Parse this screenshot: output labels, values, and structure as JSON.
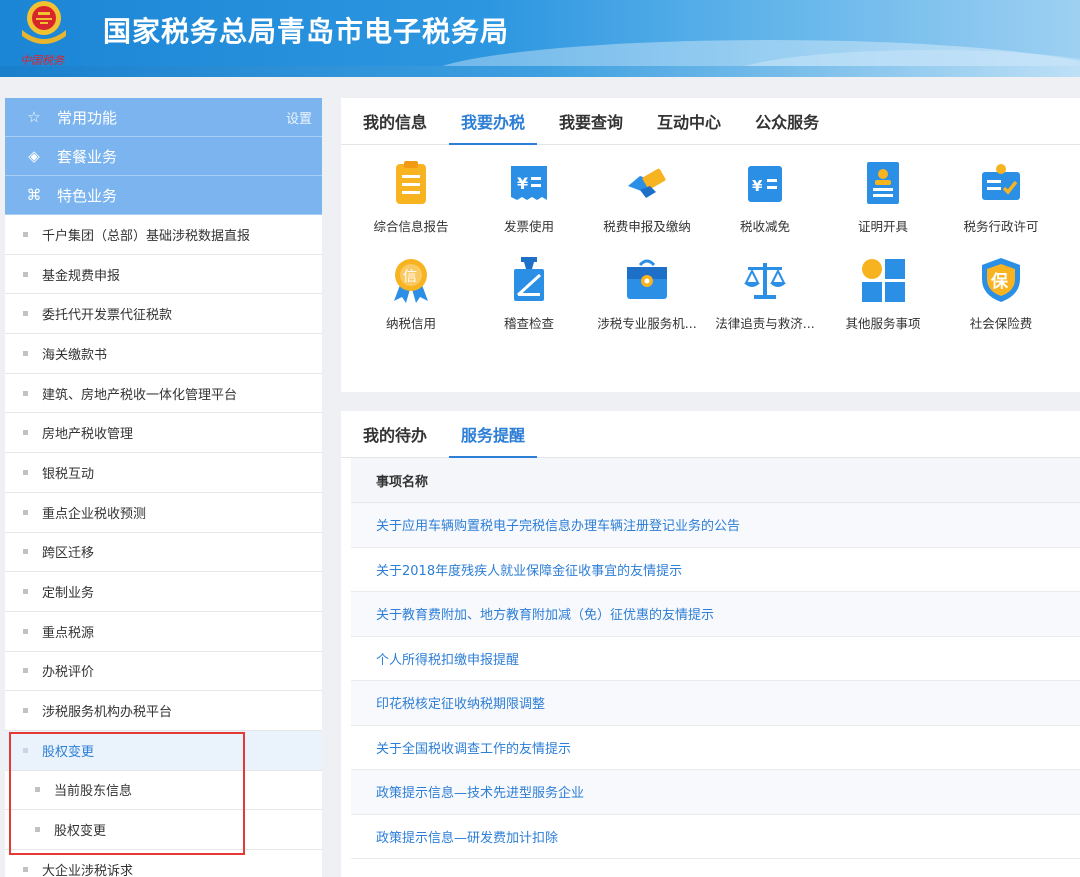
{
  "header": {
    "title": "国家税务总局青岛市电子税务局",
    "emblem_caption": "中国税务"
  },
  "sidebar": {
    "heads": [
      {
        "label": "常用功能",
        "icon": "star-icon",
        "extra": "设置"
      },
      {
        "label": "套餐业务",
        "icon": "layers-icon"
      },
      {
        "label": "特色业务",
        "icon": "cluster-icon"
      }
    ],
    "items": [
      "千户集团（总部）基础涉税数据直报",
      "基金规费申报",
      "委托代开发票代征税款",
      "海关缴款书",
      "建筑、房地产税收一体化管理平台",
      "房地产税收管理",
      "银税互动",
      "重点企业税收预测",
      "跨区迁移",
      "定制业务",
      "重点税源",
      "办税评价",
      "涉税服务机构办税平台",
      "股权变更",
      "当前股东信息",
      "股权变更",
      "大企业涉税诉求"
    ]
  },
  "main_tabs": [
    "我的信息",
    "我要办税",
    "我要查询",
    "互动中心",
    "公众服务"
  ],
  "services": [
    {
      "label": "综合信息报告",
      "icon": "clipboard-icon"
    },
    {
      "label": "发票使用",
      "icon": "invoice-icon"
    },
    {
      "label": "税费申报及缴纳",
      "icon": "payment-icon"
    },
    {
      "label": "税收减免",
      "icon": "tax-reduction-icon"
    },
    {
      "label": "证明开具",
      "icon": "certificate-icon"
    },
    {
      "label": "税务行政许可",
      "icon": "permit-icon"
    },
    {
      "label": "纳税信用",
      "icon": "credit-medal-icon"
    },
    {
      "label": "稽查检查",
      "icon": "inspection-icon"
    },
    {
      "label": "涉税专业服务机...",
      "icon": "briefcase-icon"
    },
    {
      "label": "法律追责与救济...",
      "icon": "scales-icon"
    },
    {
      "label": "其他服务事项",
      "icon": "grid-icon"
    },
    {
      "label": "社会保险费",
      "icon": "shield-bao-icon"
    }
  ],
  "todo_tabs": [
    "我的待办",
    "服务提醒"
  ],
  "table": {
    "header": "事项名称",
    "rows": [
      "关于应用车辆购置税电子完税信息办理车辆注册登记业务的公告",
      "关于2018年度残疾人就业保障金征收事宜的友情提示",
      "关于教育费附加、地方教育附加减（免）征优惠的友情提示",
      "个人所得税扣缴申报提醒",
      "印花税核定征收纳税期限调整",
      "关于全国税收调查工作的友情提示",
      "政策提示信息—技术先进型服务企业",
      "政策提示信息—研发费加计扣除"
    ]
  },
  "colors": {
    "primary": "#2d7ed6",
    "sidebar_head": "#7bb4ef",
    "highlight_box": "#e53935"
  }
}
